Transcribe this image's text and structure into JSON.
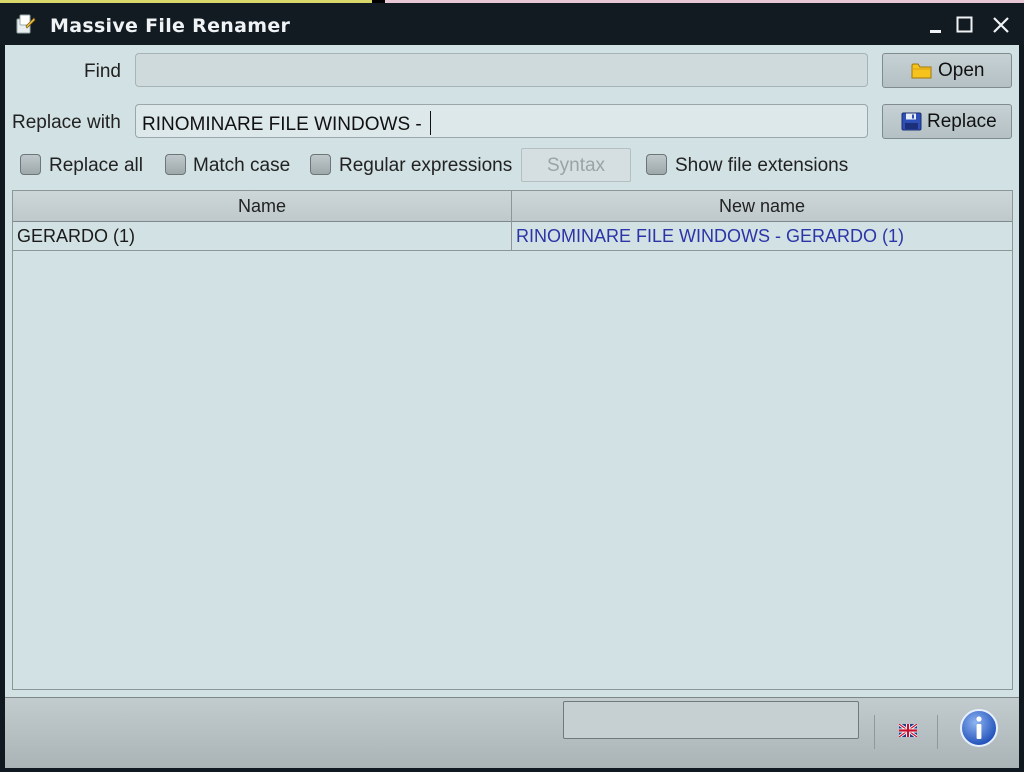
{
  "window": {
    "title": "Massive File Renamer",
    "icon": "app-icon",
    "controls": [
      "minimize-icon",
      "maximize-icon",
      "close-icon"
    ]
  },
  "form": {
    "find_label": "Find",
    "find_value": "",
    "replace_label": "Replace with",
    "replace_value": "RINOMINARE FILE WINDOWS - ",
    "open_button": "Open",
    "replace_button": "Replace"
  },
  "options": {
    "replace_all": {
      "label": "Replace all",
      "checked": false
    },
    "match_case": {
      "label": "Match case",
      "checked": false
    },
    "regex": {
      "label": "Regular expressions",
      "checked": false
    },
    "syntax_button": "Syntax",
    "show_ext": {
      "label": "Show file extensions",
      "checked": false
    }
  },
  "table": {
    "columns": [
      "Name",
      "New name"
    ],
    "rows": [
      {
        "name": "GERARDO (1)",
        "new_name": "RINOMINARE FILE WINDOWS - GERARDO (1)"
      }
    ]
  },
  "status": {
    "progress": 0,
    "language_icon": "uk-flag-icon",
    "info_icon": "info-icon"
  },
  "colors": {
    "titlebar": "#131b22",
    "background": "#d2e1e3",
    "new_name_text": "#2c35a8"
  }
}
